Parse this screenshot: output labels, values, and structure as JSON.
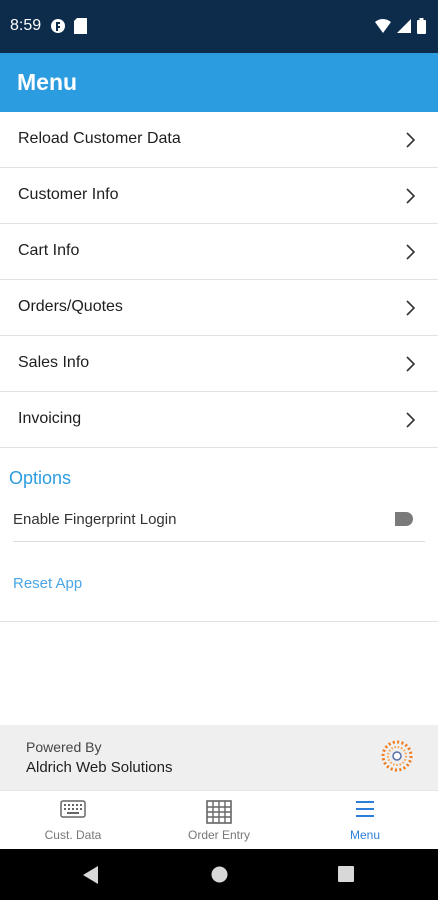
{
  "status": {
    "time": "8:59"
  },
  "appbar": {
    "title": "Menu"
  },
  "menu": {
    "items": [
      {
        "label": "Reload Customer Data"
      },
      {
        "label": "Customer Info"
      },
      {
        "label": "Cart Info"
      },
      {
        "label": "Orders/Quotes"
      },
      {
        "label": "Sales Info"
      },
      {
        "label": "Invoicing"
      }
    ]
  },
  "options": {
    "title": "Options",
    "fingerprint_label": "Enable Fingerprint Login",
    "fingerprint_enabled": false,
    "reset_label": "Reset App"
  },
  "footer": {
    "powered_by": "Powered By",
    "company": "Aldrich Web Solutions"
  },
  "tabs": [
    {
      "label": "Cust. Data",
      "icon": "keyboard-icon"
    },
    {
      "label": "Order Entry",
      "icon": "grid-icon"
    },
    {
      "label": "Menu",
      "icon": "hamburger-menu-icon",
      "active": true
    }
  ],
  "colors": {
    "accent": "#2c9ce0",
    "statusbar": "#0d2b4a",
    "active_tab": "#2c7fd9"
  }
}
